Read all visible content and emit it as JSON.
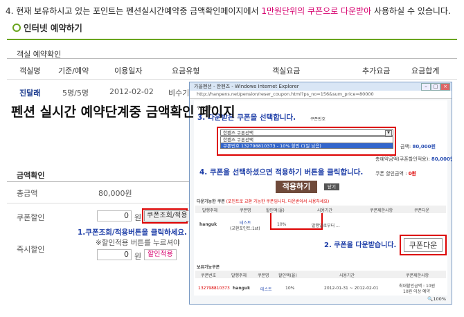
{
  "step4": {
    "pre": "4. 현재 보유하시고 있는 포인트는 펜션실시간예약중 금액확인페이지에서 ",
    "highlight": "1만원단위의 쿠폰으로 다운받아",
    "post": " 사용하실 수 있습니다."
  },
  "section_title": "인터넷 예약하기",
  "room_box": {
    "title": "객실 예약확인",
    "headers": [
      "객실명",
      "기준/예약",
      "이용일자",
      "요금유형",
      "객실요금",
      "추가요금",
      "요금합계"
    ],
    "row": {
      "name": "진달래",
      "persons": "5명/5명",
      "date": "2012-02-02",
      "rate_type": "비수기"
    }
  },
  "big_title": "펜션 실시간 예약단계중 금액확인 페이지",
  "amount": {
    "title": "금액확인",
    "total_label": "총금액",
    "total_value": "80,000원",
    "coupon_label": "쿠폰할인",
    "coupon_amount": "0",
    "won": "원",
    "coupon_lookup_button": "쿠폰조회/적용",
    "annotation_1": "1.쿠폰조회/적용버튼을 클릭하세요.",
    "note": "※할인적용 버튼를 누르셔야",
    "instant_label": "즉시할인",
    "instant_amount": "0",
    "discount_apply_button": "할인적용"
  },
  "popup": {
    "window_title": "가을펜션 - 한펜즈 - Windows Internet Explorer",
    "address": "http://hanpens.net/pension/reser_coupon.html?ps_no=156&sum_price=80000",
    "coupon_apply_label": "쿠폰적용",
    "step3": "3. 다운받은 쿠폰을 선택합니다.",
    "coupon_number_label": "쿠폰번호",
    "select_value": "한펜즈 쿠폰선택",
    "options": [
      "한펜즈 쿠폰선택",
      "쿠폰번호 132798810373 - 10% 할인 (1일 남음)"
    ],
    "amount_label": "금액:",
    "amount_value": "80,000원",
    "total_amount_label": "총예약금액(쿠폰할인적용):",
    "total_amount_value": "80,000원",
    "step4": "4. 쿠폰을 선택하셨으면 적용하기 버튼을 클릭합니다.",
    "discount_label": "쿠폰 할인금액 :",
    "discount_value": "0원",
    "apply_button": "적용하기",
    "close_button": "닫기",
    "downloadable_label": "다운가능한 쿠폰",
    "downloadable_note": "(포인트로 교환 가능한 쿠폰입니다. 다운받아서 사용하세요)",
    "table1_headers": [
      "발행주체",
      "쿠폰명",
      "할인액(율)",
      "사용기간",
      "쿠폰제한사항",
      "쿠폰다운"
    ],
    "table1_row": {
      "issuer": "hanguk",
      "name": "테스트",
      "name_sub": "(교환포인트:1st)",
      "rate": "10%",
      "period": "발행일로부터 ..."
    },
    "step2": "2. 쿠폰을 다운받습니다.",
    "download_button": "쿠폰다운",
    "owned_label": "보유가능쿠폰",
    "table2_headers": [
      "쿠폰번호",
      "발행주체",
      "쿠폰명",
      "할인액(율)",
      "사용기간",
      "쿠폰제한사항"
    ],
    "table2_row": {
      "number": "132798810373",
      "issuer": "hanguk",
      "name": "테스트",
      "rate": "10%",
      "period": "2012-01-31 ~ 2012-02-01",
      "limit1": "최대할인금액 : 10원",
      "limit2": "10원 이상 예약"
    },
    "zoom": "100%"
  }
}
